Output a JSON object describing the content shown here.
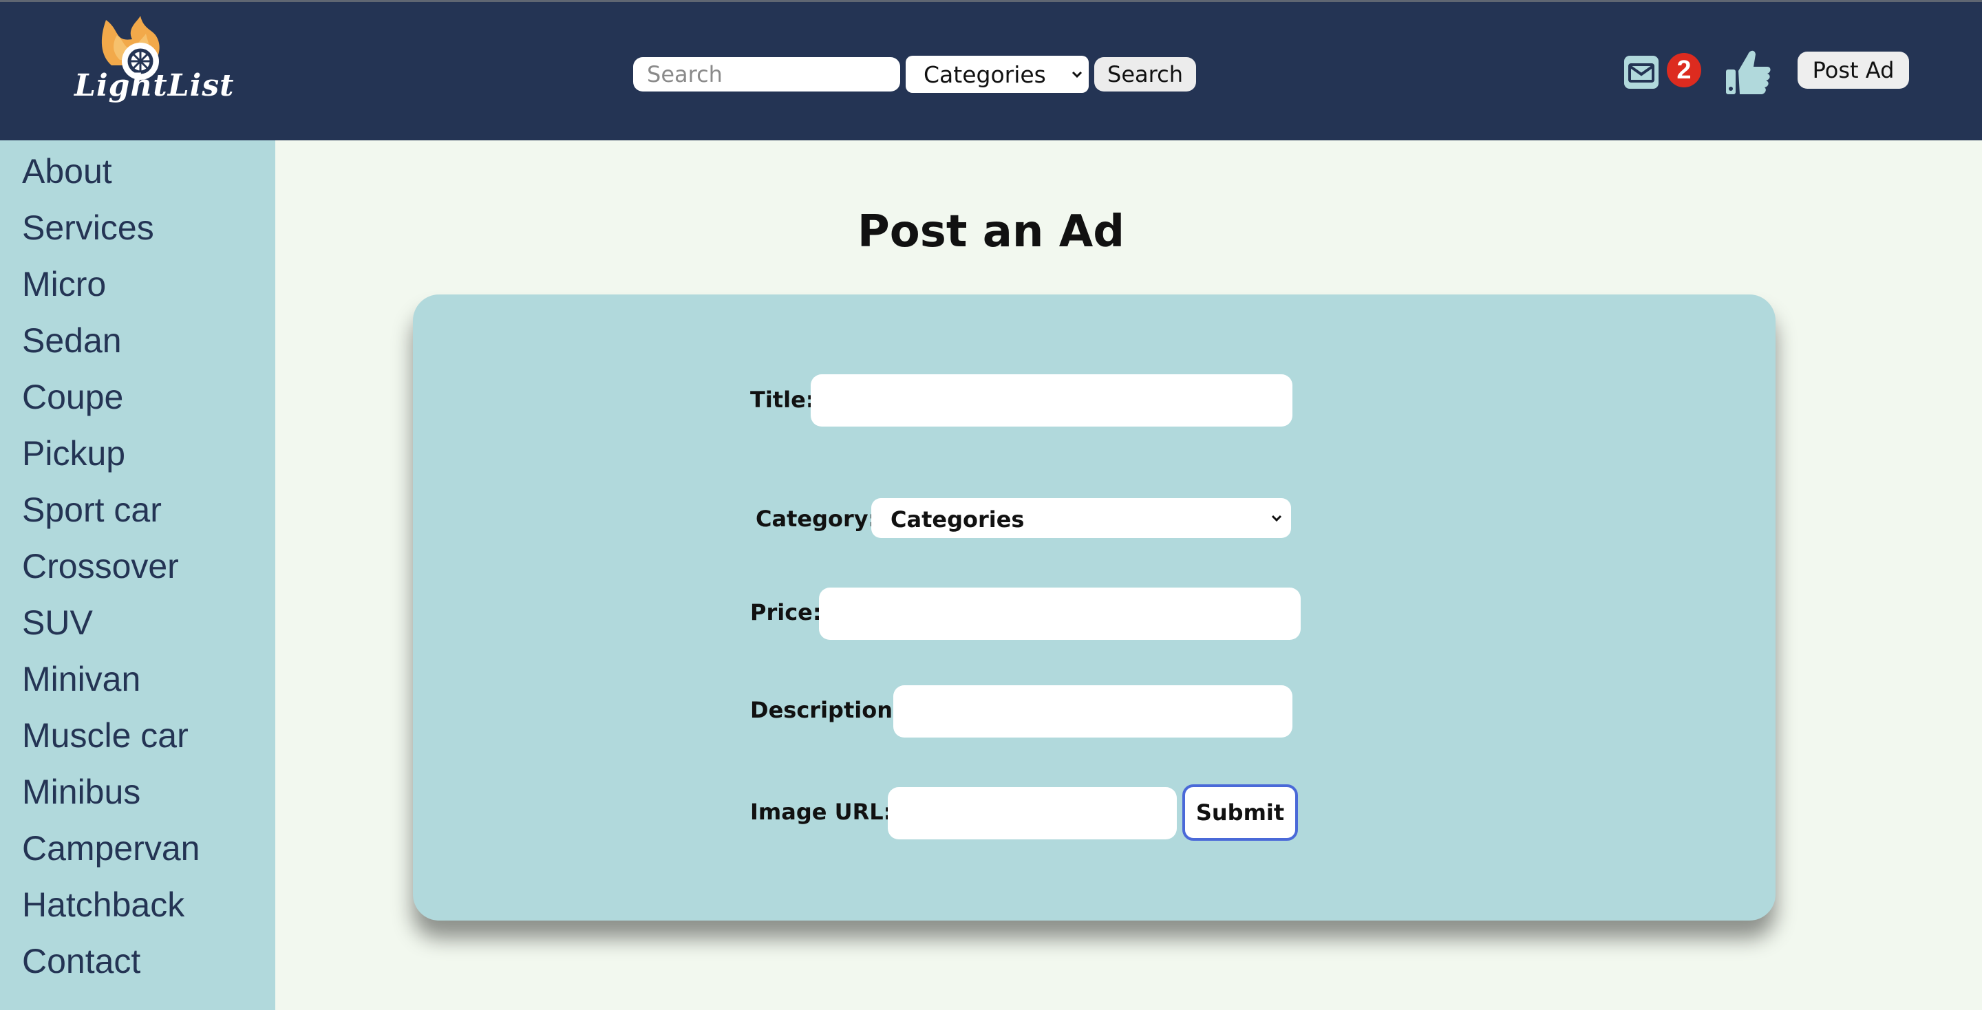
{
  "header": {
    "logo_text": "LightList",
    "search": {
      "placeholder": "Search",
      "value": ""
    },
    "category_select": {
      "selected": "Categories"
    },
    "search_button_label": "Search",
    "messages_badge_count": "2",
    "post_ad_label": "Post Ad"
  },
  "sidebar": {
    "items": [
      {
        "label": "About"
      },
      {
        "label": "Services"
      },
      {
        "label": "Micro"
      },
      {
        "label": "Sedan"
      },
      {
        "label": "Coupe"
      },
      {
        "label": "Pickup"
      },
      {
        "label": "Sport car"
      },
      {
        "label": "Crossover"
      },
      {
        "label": "SUV"
      },
      {
        "label": "Minivan"
      },
      {
        "label": "Muscle car"
      },
      {
        "label": "Minibus"
      },
      {
        "label": "Campervan"
      },
      {
        "label": "Hatchback"
      },
      {
        "label": "Contact"
      }
    ]
  },
  "main": {
    "title": "Post an Ad",
    "form": {
      "title_label": "Title:",
      "title_value": "",
      "category_label": "Category:",
      "category_selected": "Categories",
      "price_label": "Price:",
      "price_value": "",
      "description_label": "Description:",
      "description_value": "",
      "image_url_label": "Image URL:",
      "image_url_value": "",
      "submit_label": "Submit"
    }
  },
  "colors": {
    "header_bg": "#243454",
    "sidebar_bg": "#b1d9dc",
    "card_bg": "#b1d9dc",
    "page_bg": "#f2f8ef",
    "badge": "#dd2b1f",
    "submit_border": "#4a69d8",
    "logo_flame": "#f2a94a"
  },
  "icons": {
    "mail": "envelope-icon",
    "like": "thumbs-up-icon",
    "select_arrow": "chevron-down-icon"
  }
}
